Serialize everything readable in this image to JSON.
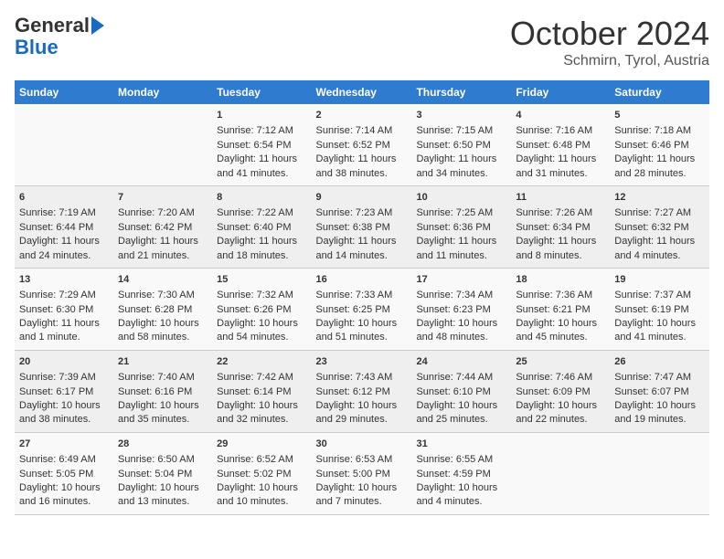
{
  "header": {
    "logo_general": "General",
    "logo_blue": "Blue",
    "month": "October 2024",
    "location": "Schmirn, Tyrol, Austria"
  },
  "columns": [
    "Sunday",
    "Monday",
    "Tuesday",
    "Wednesday",
    "Thursday",
    "Friday",
    "Saturday"
  ],
  "weeks": [
    [
      {
        "day": "",
        "info": ""
      },
      {
        "day": "",
        "info": ""
      },
      {
        "day": "1",
        "info": "Sunrise: 7:12 AM\nSunset: 6:54 PM\nDaylight: 11 hours and 41 minutes."
      },
      {
        "day": "2",
        "info": "Sunrise: 7:14 AM\nSunset: 6:52 PM\nDaylight: 11 hours and 38 minutes."
      },
      {
        "day": "3",
        "info": "Sunrise: 7:15 AM\nSunset: 6:50 PM\nDaylight: 11 hours and 34 minutes."
      },
      {
        "day": "4",
        "info": "Sunrise: 7:16 AM\nSunset: 6:48 PM\nDaylight: 11 hours and 31 minutes."
      },
      {
        "day": "5",
        "info": "Sunrise: 7:18 AM\nSunset: 6:46 PM\nDaylight: 11 hours and 28 minutes."
      }
    ],
    [
      {
        "day": "6",
        "info": "Sunrise: 7:19 AM\nSunset: 6:44 PM\nDaylight: 11 hours and 24 minutes."
      },
      {
        "day": "7",
        "info": "Sunrise: 7:20 AM\nSunset: 6:42 PM\nDaylight: 11 hours and 21 minutes."
      },
      {
        "day": "8",
        "info": "Sunrise: 7:22 AM\nSunset: 6:40 PM\nDaylight: 11 hours and 18 minutes."
      },
      {
        "day": "9",
        "info": "Sunrise: 7:23 AM\nSunset: 6:38 PM\nDaylight: 11 hours and 14 minutes."
      },
      {
        "day": "10",
        "info": "Sunrise: 7:25 AM\nSunset: 6:36 PM\nDaylight: 11 hours and 11 minutes."
      },
      {
        "day": "11",
        "info": "Sunrise: 7:26 AM\nSunset: 6:34 PM\nDaylight: 11 hours and 8 minutes."
      },
      {
        "day": "12",
        "info": "Sunrise: 7:27 AM\nSunset: 6:32 PM\nDaylight: 11 hours and 4 minutes."
      }
    ],
    [
      {
        "day": "13",
        "info": "Sunrise: 7:29 AM\nSunset: 6:30 PM\nDaylight: 11 hours and 1 minute."
      },
      {
        "day": "14",
        "info": "Sunrise: 7:30 AM\nSunset: 6:28 PM\nDaylight: 10 hours and 58 minutes."
      },
      {
        "day": "15",
        "info": "Sunrise: 7:32 AM\nSunset: 6:26 PM\nDaylight: 10 hours and 54 minutes."
      },
      {
        "day": "16",
        "info": "Sunrise: 7:33 AM\nSunset: 6:25 PM\nDaylight: 10 hours and 51 minutes."
      },
      {
        "day": "17",
        "info": "Sunrise: 7:34 AM\nSunset: 6:23 PM\nDaylight: 10 hours and 48 minutes."
      },
      {
        "day": "18",
        "info": "Sunrise: 7:36 AM\nSunset: 6:21 PM\nDaylight: 10 hours and 45 minutes."
      },
      {
        "day": "19",
        "info": "Sunrise: 7:37 AM\nSunset: 6:19 PM\nDaylight: 10 hours and 41 minutes."
      }
    ],
    [
      {
        "day": "20",
        "info": "Sunrise: 7:39 AM\nSunset: 6:17 PM\nDaylight: 10 hours and 38 minutes."
      },
      {
        "day": "21",
        "info": "Sunrise: 7:40 AM\nSunset: 6:16 PM\nDaylight: 10 hours and 35 minutes."
      },
      {
        "day": "22",
        "info": "Sunrise: 7:42 AM\nSunset: 6:14 PM\nDaylight: 10 hours and 32 minutes."
      },
      {
        "day": "23",
        "info": "Sunrise: 7:43 AM\nSunset: 6:12 PM\nDaylight: 10 hours and 29 minutes."
      },
      {
        "day": "24",
        "info": "Sunrise: 7:44 AM\nSunset: 6:10 PM\nDaylight: 10 hours and 25 minutes."
      },
      {
        "day": "25",
        "info": "Sunrise: 7:46 AM\nSunset: 6:09 PM\nDaylight: 10 hours and 22 minutes."
      },
      {
        "day": "26",
        "info": "Sunrise: 7:47 AM\nSunset: 6:07 PM\nDaylight: 10 hours and 19 minutes."
      }
    ],
    [
      {
        "day": "27",
        "info": "Sunrise: 6:49 AM\nSunset: 5:05 PM\nDaylight: 10 hours and 16 minutes."
      },
      {
        "day": "28",
        "info": "Sunrise: 6:50 AM\nSunset: 5:04 PM\nDaylight: 10 hours and 13 minutes."
      },
      {
        "day": "29",
        "info": "Sunrise: 6:52 AM\nSunset: 5:02 PM\nDaylight: 10 hours and 10 minutes."
      },
      {
        "day": "30",
        "info": "Sunrise: 6:53 AM\nSunset: 5:00 PM\nDaylight: 10 hours and 7 minutes."
      },
      {
        "day": "31",
        "info": "Sunrise: 6:55 AM\nSunset: 4:59 PM\nDaylight: 10 hours and 4 minutes."
      },
      {
        "day": "",
        "info": ""
      },
      {
        "day": "",
        "info": ""
      }
    ]
  ]
}
